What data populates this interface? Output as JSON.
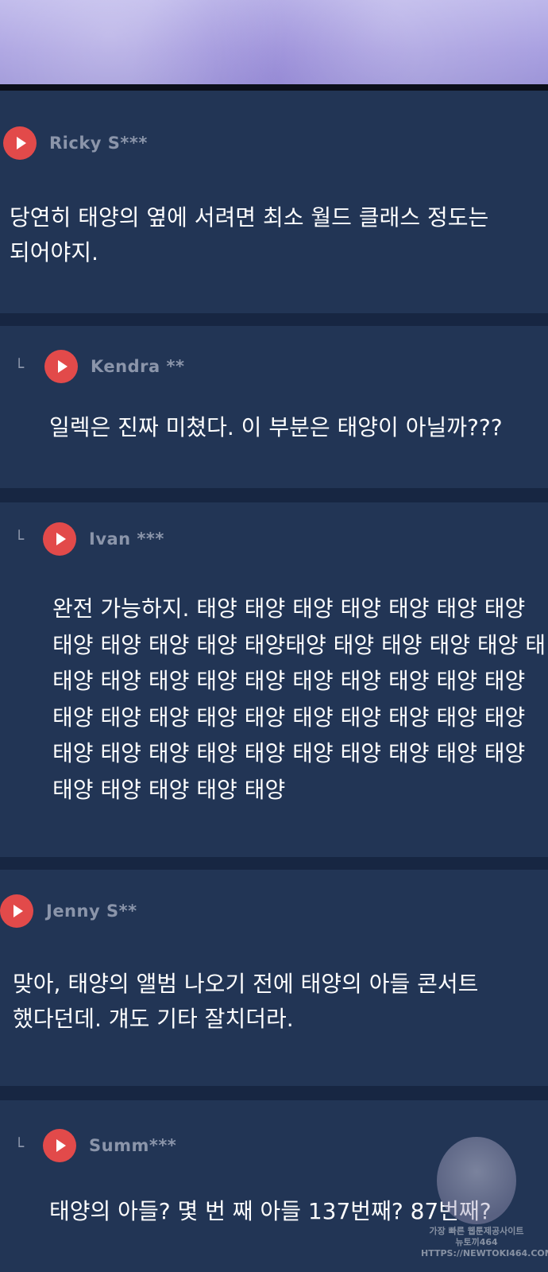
{
  "comments": [
    {
      "author": "Ricky S***",
      "reply": false,
      "text": "당연히 태양의 옆에 서려면 최소 월드 클래스 정도는\n되어야지."
    },
    {
      "author": "Kendra **",
      "reply": true,
      "text": "일렉은 진짜 미쳤다. 이 부분은 태양이 아닐까???"
    },
    {
      "author": "Ivan ***",
      "reply": true,
      "text": "완전 가능하지. 태양 태양 태양 태양 태양 태양 태양\n태양 태양 태양 태양 태양태양 태양 태양 태양 태양 태\n태양 태양 태양 태양 태양 태양 태양 태양 태양 태양\n태양 태양 태양 태양 태양 태양 태양 태양 태양 태양\n태양 태양 태양 태양 태양 태양 태양 태양 태양 태양\n태양 태양 태양 태양 태양"
    },
    {
      "author": "Jenny S**",
      "reply": false,
      "text": "맞아, 태양의 앨범 나오기 전에 태양의 아들 콘서트\n했다던데. 걔도 기타 잘치더라."
    },
    {
      "author": "Summ***",
      "reply": true,
      "text": "태양의 아들? 몇 번 째 아들 137번째? 87번째?"
    }
  ],
  "reply_marker": "└",
  "watermark": {
    "line1": "가장 빠른 웹툰제공사이트",
    "line2": "뉴토끼464",
    "line3": "HTTPS://NEWTOKI464.COM"
  },
  "colors": {
    "card": "#223555",
    "separator": "#172642",
    "play_icon": "#e24a4a",
    "author": "#8b95aa",
    "text": "#ffffff"
  }
}
